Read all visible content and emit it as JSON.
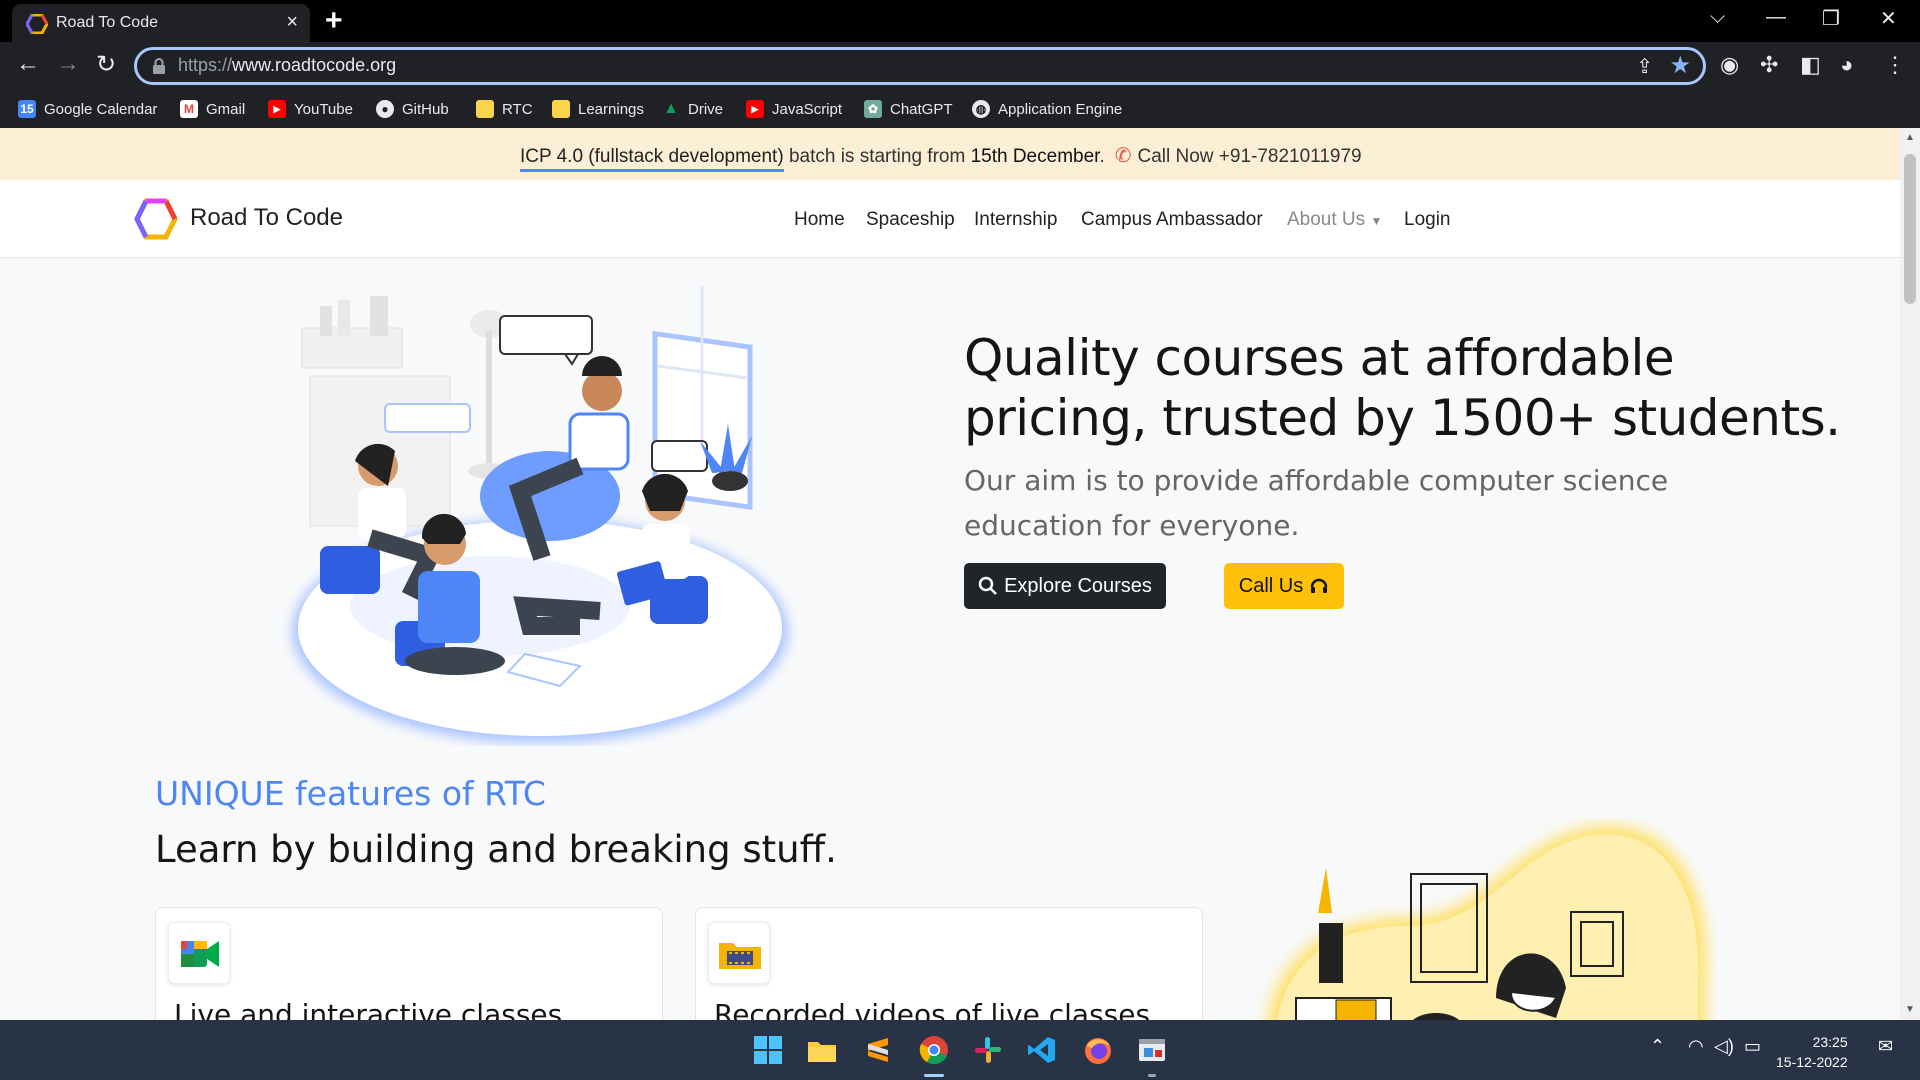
{
  "browser": {
    "tab_title": "Road To Code",
    "tab_close": "×",
    "new_tab": "+",
    "url_scheme": "https://",
    "url_host": "www.roadtocode.org",
    "window_controls": {
      "dropdown": "⌵",
      "minimize": "—",
      "restore": "❐",
      "close": "✕"
    },
    "bookmarks": [
      {
        "label": "Google Calendar",
        "icon": "calendar-icon",
        "color": "#4285f4",
        "glyph": "15"
      },
      {
        "label": "Gmail",
        "icon": "gmail-icon",
        "color": "#ea4335",
        "glyph": "M"
      },
      {
        "label": "YouTube",
        "icon": "youtube-icon",
        "color": "#ff0000",
        "glyph": "▶"
      },
      {
        "label": "GitHub",
        "icon": "github-icon",
        "color": "#e8eaed",
        "glyph": "●"
      },
      {
        "label": "RTC",
        "icon": "folder-icon",
        "color": "#fcd34d",
        "glyph": ""
      },
      {
        "label": "Learnings",
        "icon": "folder-icon",
        "color": "#fcd34d",
        "glyph": ""
      },
      {
        "label": "Drive",
        "icon": "drive-icon",
        "color": "#0f9d58",
        "glyph": "▲"
      },
      {
        "label": "JavaScript",
        "icon": "youtube-icon",
        "color": "#ff0000",
        "glyph": "▶"
      },
      {
        "label": "ChatGPT",
        "icon": "chatgpt-icon",
        "color": "#74aa9c",
        "glyph": "✿"
      },
      {
        "label": "Application Engine",
        "icon": "globe-icon",
        "color": "#5f6368",
        "glyph": "◍"
      }
    ]
  },
  "announcement": {
    "highlight": "ICP 4.0 (fullstack development)",
    "middle": " batch is starting from ",
    "date": "15th December",
    "after_date": ".",
    "call_label": "Call Now +91-7821011979"
  },
  "nav": {
    "brand": "Road To Code",
    "links": [
      "Home",
      "Spaceship",
      "Internship",
      "Campus Ambassador",
      "About Us",
      "Login"
    ]
  },
  "hero": {
    "title": "Quality courses at affordable pricing, trusted by 1500+ students.",
    "subtitle": "Our aim is to provide affordable computer science education for everyone.",
    "explore_btn": "Explore Courses",
    "call_btn": "Call Us"
  },
  "features": {
    "heading": "UNIQUE features of RTC",
    "subheading": "Learn by building and breaking stuff.",
    "cards": [
      {
        "title": "Live and interactive classes.",
        "icon": "google-meet-icon"
      },
      {
        "title": "Recorded videos of live classes.",
        "icon": "video-folder-icon"
      }
    ]
  },
  "taskbar": {
    "time": "23:25",
    "date": "15-12-2022",
    "apps": [
      "windows-start-icon",
      "file-explorer-icon",
      "sublime-text-icon",
      "chrome-icon",
      "slack-icon",
      "vscode-icon",
      "firefox-icon",
      "app-window-icon"
    ]
  },
  "colors": {
    "accent": "#4f86f7",
    "announcement_bg": "#fdefd6",
    "call_button": "#ffc107",
    "explore_button": "#212529"
  }
}
